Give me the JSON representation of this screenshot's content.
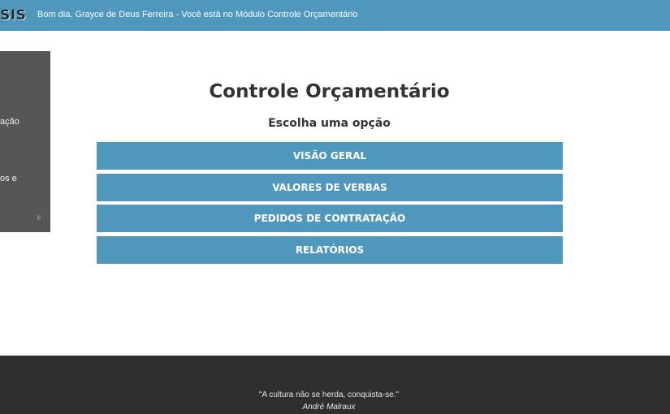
{
  "header": {
    "logo_text": "SIS",
    "greeting": "Bom dia, Grayce de Deus Ferreira - Você está no Módulo Controle Orçamentário"
  },
  "sidebar": {
    "items": [
      {
        "label": "ação"
      },
      {
        "label": "os e"
      }
    ]
  },
  "main": {
    "title": "Controle Orçamentário",
    "subtitle": "Escolha uma opção",
    "options": [
      {
        "label": "VISÃO GERAL"
      },
      {
        "label": "VALORES DE VERBAS"
      },
      {
        "label": "PEDIDOS DE CONTRATAÇÃO"
      },
      {
        "label": "RELATÓRIOS"
      }
    ]
  },
  "footer": {
    "quote": "\"A cultura não se herda, conquista-se.\"",
    "author": "André Malraux"
  },
  "colors": {
    "accent": "#4f97bd",
    "sidebar": "#565656",
    "footer": "#2f2f2f"
  }
}
